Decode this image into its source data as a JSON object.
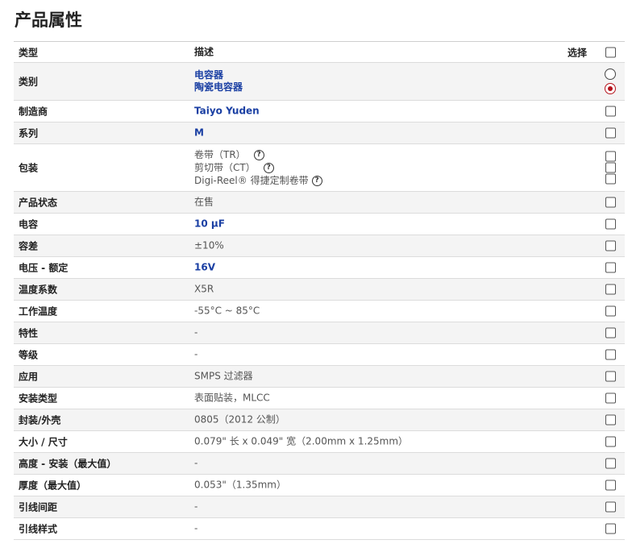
{
  "page": {
    "title": "产品属性"
  },
  "header": {
    "type_label": "类型",
    "desc_label": "描述",
    "select_label": "选择"
  },
  "category": {
    "type": "类别",
    "values": [
      "电容器",
      "陶瓷电容器"
    ],
    "selected_index": 1
  },
  "packaging": {
    "type": "包装",
    "options": [
      "卷带（TR）",
      "剪切带（CT）",
      "Digi-Reel® 得捷定制卷带"
    ],
    "help_icon": "question-circle-icon"
  },
  "rows": [
    {
      "type": "制造商",
      "value": "Taiyo Yuden",
      "link": true
    },
    {
      "type": "系列",
      "value": "M",
      "link": true
    },
    {
      "type": "产品状态",
      "value": "在售",
      "link": false
    },
    {
      "type": "电容",
      "value": "10 µF",
      "link": true
    },
    {
      "type": "容差",
      "value": "±10%",
      "link": false
    },
    {
      "type": "电压 - 额定",
      "value": "16V",
      "link": true
    },
    {
      "type": "温度系数",
      "value": "X5R",
      "link": false
    },
    {
      "type": "工作温度",
      "value": "-55°C ~ 85°C",
      "link": false
    },
    {
      "type": "特性",
      "value": "-",
      "link": false
    },
    {
      "type": "等级",
      "value": "-",
      "link": false
    },
    {
      "type": "应用",
      "value": "SMPS 过滤器",
      "link": false
    },
    {
      "type": "安装类型",
      "value": "表面贴装，MLCC",
      "link": false
    },
    {
      "type": "封装/外壳",
      "value": "0805（2012 公制）",
      "link": false
    },
    {
      "type": "大小 / 尺寸",
      "value": "0.079\" 长 x 0.049\" 宽（2.00mm x 1.25mm）",
      "link": false
    },
    {
      "type": "高度 - 安装（最大值）",
      "value": "-",
      "link": false
    },
    {
      "type": "厚度（最大值）",
      "value": "0.053\"（1.35mm）",
      "link": false
    },
    {
      "type": "引线间距",
      "value": "-",
      "link": false
    },
    {
      "type": "引线样式",
      "value": "-",
      "link": false
    }
  ],
  "colors": {
    "link": "#1a3fa3",
    "radio_selected": "#b5121b",
    "row_alt_bg": "#f4f4f4"
  }
}
